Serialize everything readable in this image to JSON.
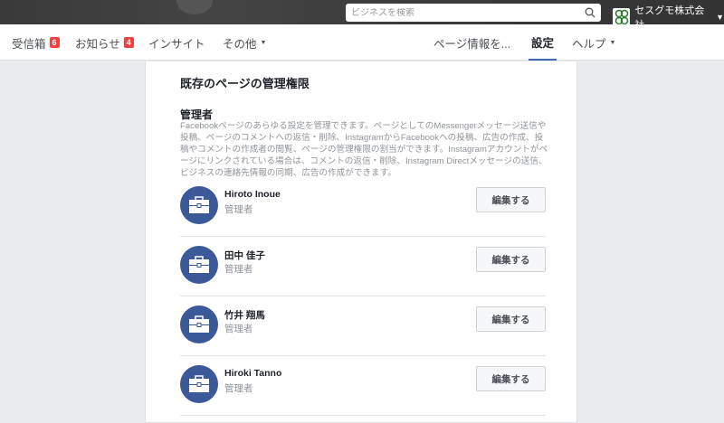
{
  "topbar": {
    "search_placeholder": "ビジネスを検索",
    "account_name": "セスグモ株式会社"
  },
  "nav": {
    "inbox": "受信箱",
    "inbox_count": "6",
    "notifications": "お知らせ",
    "notifications_count": "4",
    "insights": "インサイト",
    "more": "その他",
    "page_info": "ページ情報を...",
    "settings": "設定",
    "help": "ヘルプ"
  },
  "main": {
    "title": "既存のページの管理権限",
    "section": "管理者",
    "description": "Facebookページのあらゆる設定を管理できます。ページとしてのMessengerメッセージ送信や投稿、ページのコメントへの返信・削除、InstagramからFacebookへの投稿、広告の作成、投稿やコメントの作成者の閲覧、ページの管理権限の割当ができます。Instagramアカウントがページにリンクされている場合は、コメントの返信・削除、Instagram Directメッセージの送信、ビジネスの連絡先情報の同期、広告の作成ができます。",
    "people": [
      {
        "name": "Hiroto Inoue",
        "role": "管理者",
        "button": "編集する"
      },
      {
        "name": "田中 佳子",
        "role": "管理者",
        "button": "編集する"
      },
      {
        "name": "竹井 翔馬",
        "role": "管理者",
        "button": "編集する"
      },
      {
        "name": "Hiroki Tanno",
        "role": "管理者",
        "button": "編集する"
      }
    ]
  }
}
